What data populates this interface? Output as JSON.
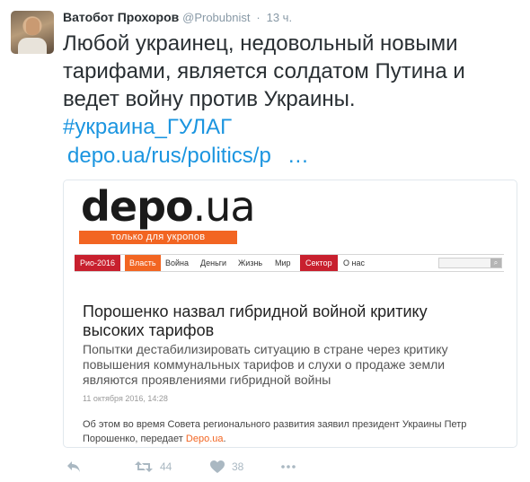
{
  "tweet": {
    "author_name": "Ватобот Прохоров",
    "author_handle": "@Probubnist",
    "separator": "·",
    "time": "13 ч.",
    "text": "Любой украинец, недовольный новыми тарифами, является солдатом Путина и ведет войну против Украины.",
    "hashtag": "#украина_ГУЛАГ",
    "link": "depo.ua/rus/politics/p",
    "link_ellipsis": "…"
  },
  "card": {
    "logo_word": "depo",
    "logo_suffix": ".ua",
    "tagline": "только для укропов",
    "nav": {
      "items": [
        "Рио-2016",
        "Власть",
        "Война",
        "Деньги",
        "Жизнь",
        "Мир",
        "Сектор",
        "О нас"
      ],
      "search_icon": "search-icon"
    },
    "headline": "Порошенко назвал гибридной войной критику высоких тарифов",
    "lead": "Попытки дестабилизировать ситуацию в стране через критику повышения коммунальных тарифов и слухи о продаже земли являются проявлениями гибридной войны",
    "date": "11 октября 2016, 14:28",
    "body": "Об этом во время Совета регионального развития заявил президент Украины Петр Порошенко, передает",
    "body_source": "Depo.ua",
    "body_end": "."
  },
  "actions": {
    "reply_icon": "reply-icon",
    "retweet_icon": "retweet-icon",
    "retweet_count": "44",
    "like_icon": "heart-icon",
    "like_count": "38",
    "more_icon": "more-icon"
  },
  "colors": {
    "link_blue": "#1b95e0",
    "brand_orange": "#f26522",
    "nav_red": "#c8202e",
    "muted_gray": "#8899a6"
  }
}
